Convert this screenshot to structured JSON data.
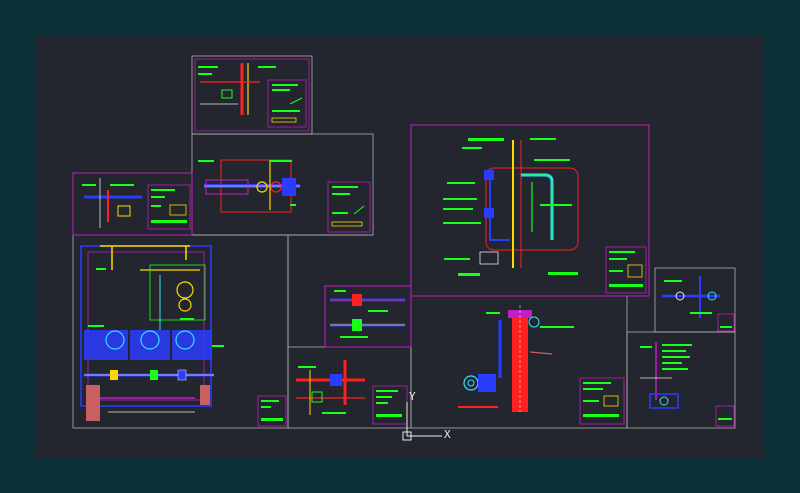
{
  "ucs": {
    "y_label": "Y",
    "x_label": "X"
  },
  "colors": {
    "background": "#23262e",
    "outer": "#0e3138",
    "sheet_border": "#b0b0b0",
    "magenta": "#c21fc2",
    "green": "#18ff18",
    "blue": "#2a3cff",
    "red": "#ff2020",
    "yellow": "#ffd800",
    "cyan": "#30e0ff",
    "white": "#e8e8e8"
  }
}
